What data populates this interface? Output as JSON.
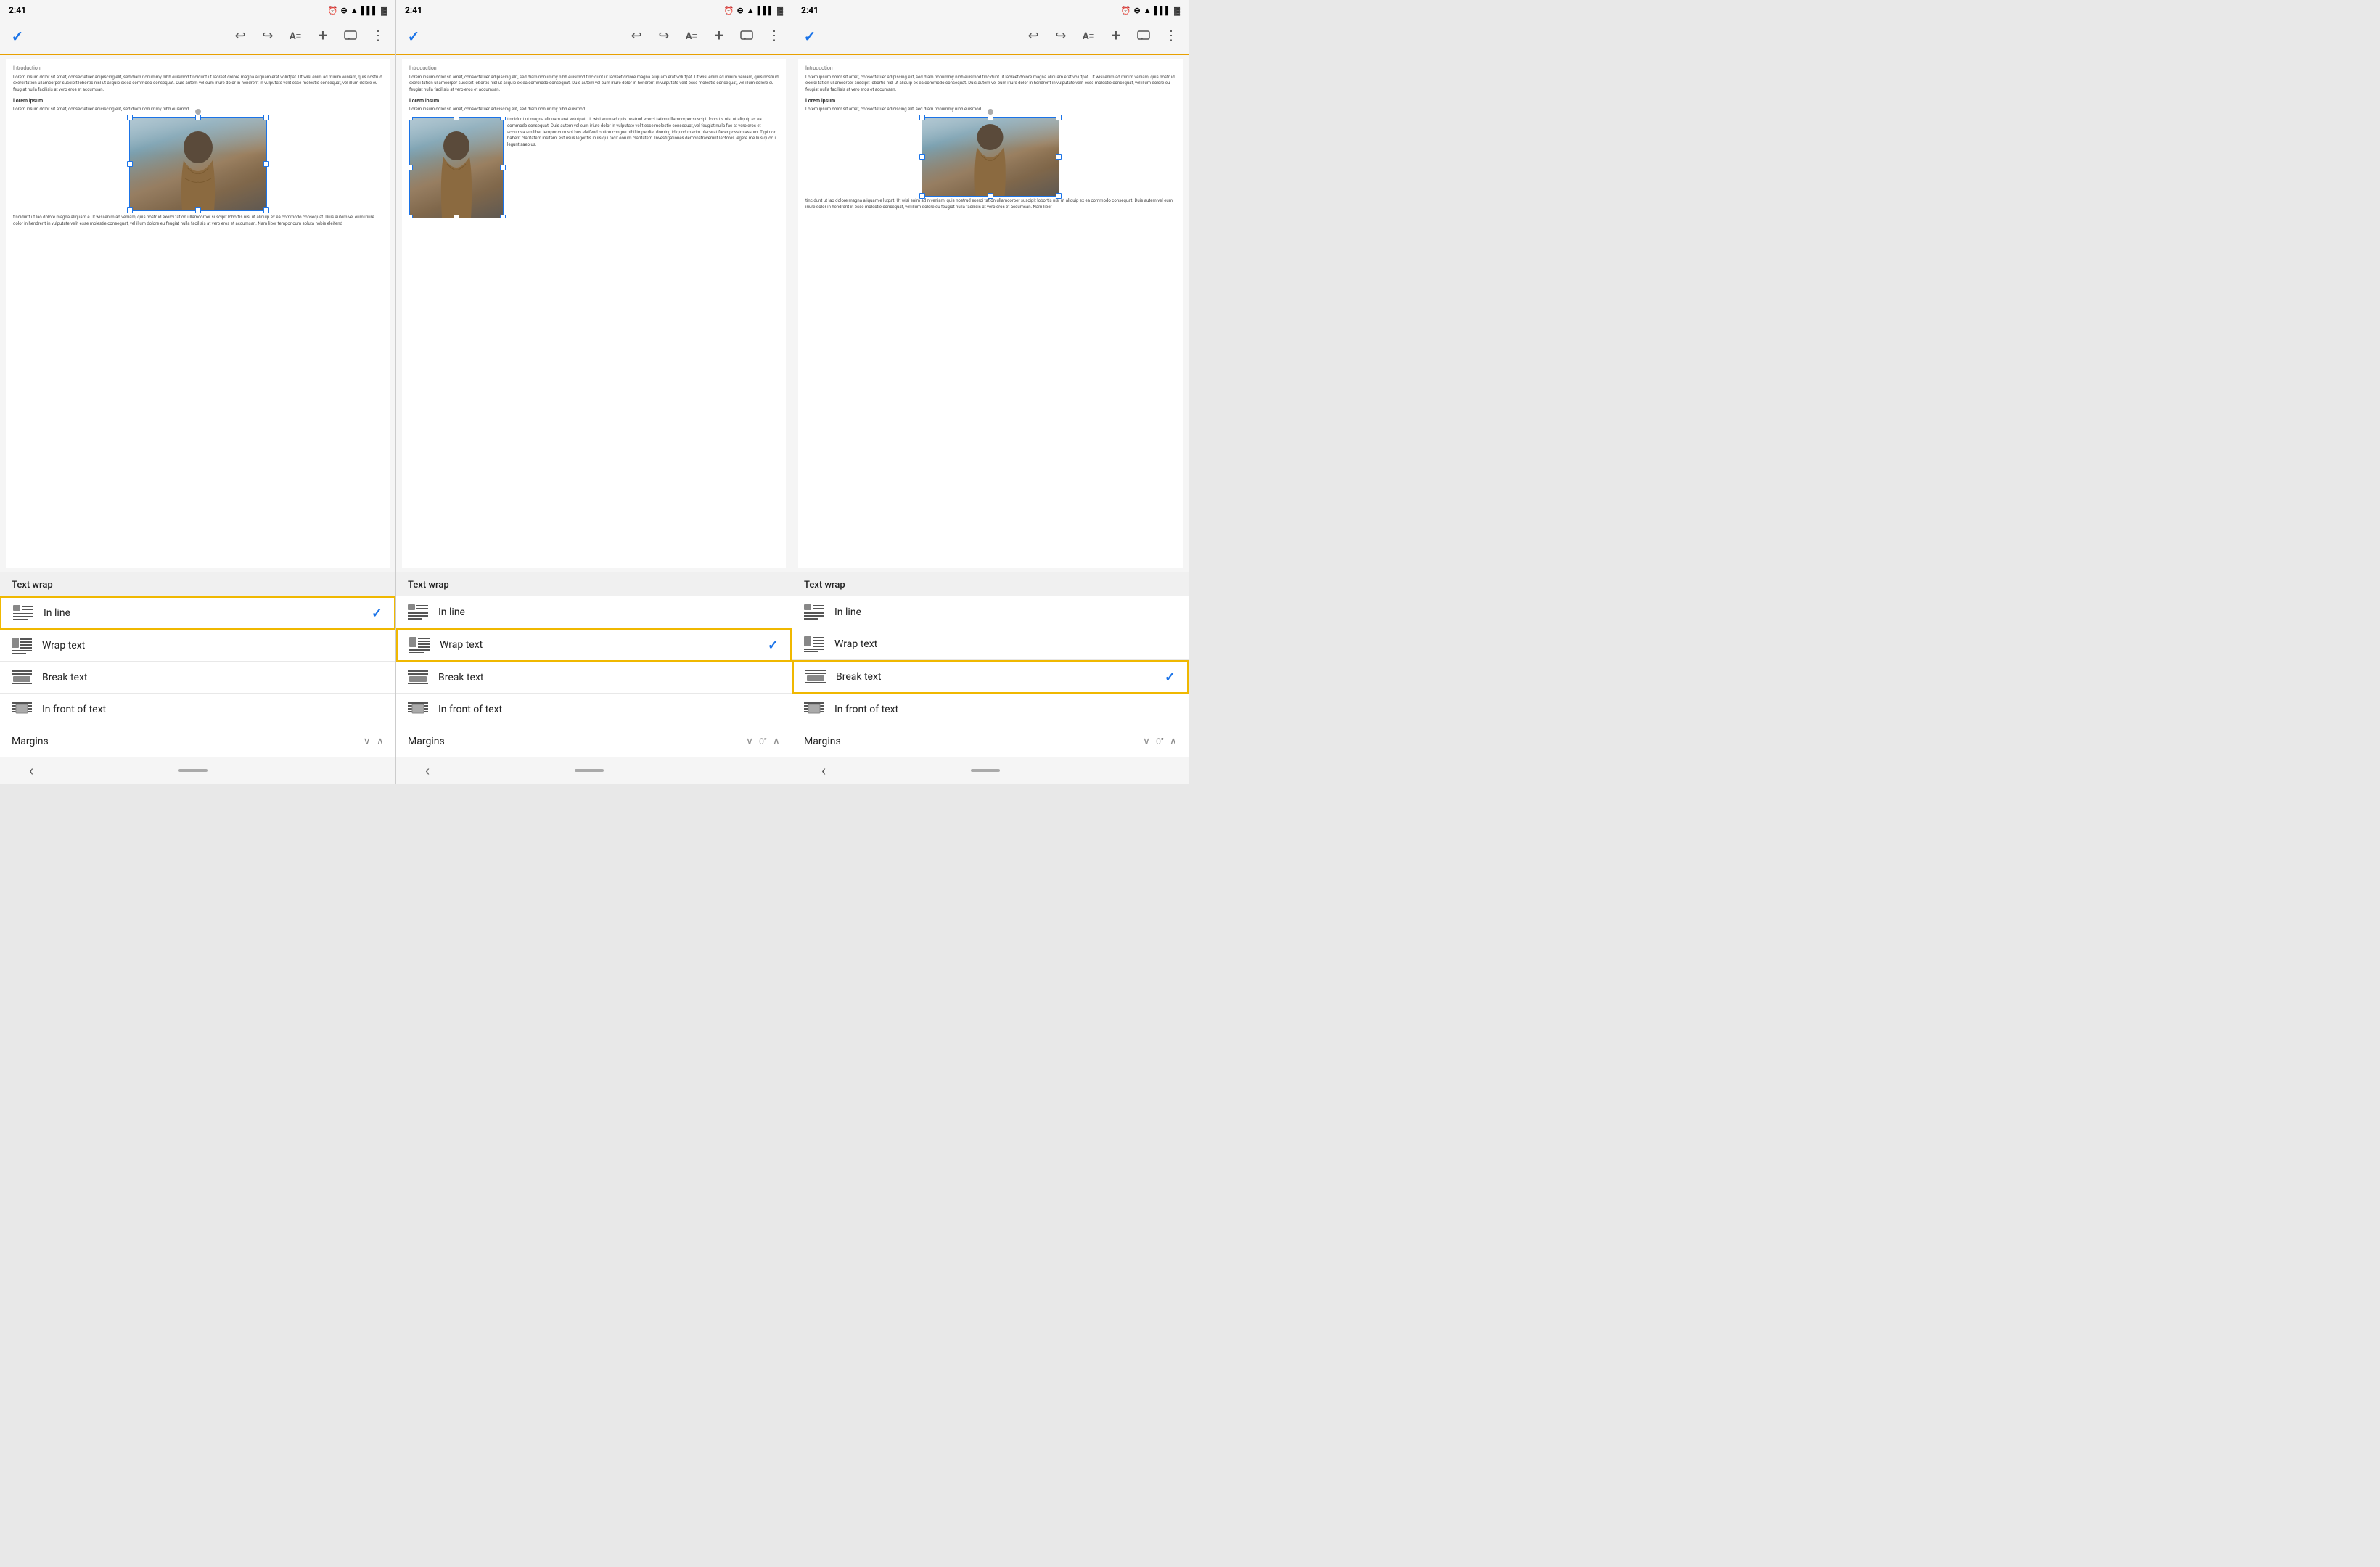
{
  "panels": [
    {
      "id": "panel1",
      "time": "2:41",
      "toolbar": {
        "check": "✓",
        "undo": "↩",
        "redo": "↪",
        "format": "A≡",
        "add": "+",
        "comment": "💬",
        "more": "⋮"
      },
      "doc": {
        "intro_label": "Introduction",
        "body_text": "Lorem ipsum dolor sit amet, consectetuer adipiscing elit, sed diam nonummy nibh euismod tincidunt ut laoreet dolore magna aliquam erat volutpat. Ut wisi enim ad minim veniam, quis nostrud exerci tation ullamcorper suscipit lobortis nisl ut aliquip ex ea commodo consequat. Duis autem vel eum iriure dolor in hendrerit in vulputate velit esse molestie consequat, vel illum dolore eu feugiat nulla facilisis at vero eros et accumsan.",
        "bold_heading": "Lorem ipsum",
        "sub_text": "Lorem ipsum dolor sit amet, consectetuer adiciscing elit, sed diam nonummy nibh euismod",
        "text_after": "tincidunt ut laor    dolore magna aliquam e    Ut wisi enim ad    veniam, quis nostrud exerci tation ullamcorper suscipit lobortis nisl ut aliquip ex ea commodo consequat. Duis autem vel eum iriure dolor in hendrerit in vulputate velit esse molestie consequat, vel illum dolore eu feugiat nulla facilisis at vero eros et accumsan. Nam liber tempor cum soluta nobis eleifend"
      },
      "wrap_type": "inline",
      "textwrap": {
        "header": "Text wrap",
        "items": [
          {
            "id": "inline",
            "label": "In line",
            "selected": true,
            "checked": true
          },
          {
            "id": "wrap",
            "label": "Wrap text",
            "selected": false,
            "checked": false
          },
          {
            "id": "break",
            "label": "Break text",
            "selected": false,
            "checked": false
          },
          {
            "id": "front",
            "label": "In front of text",
            "selected": false,
            "checked": false
          }
        ],
        "margins_label": "Margins",
        "margins_value": ""
      }
    },
    {
      "id": "panel2",
      "time": "2:41",
      "wrap_type": "wrap",
      "textwrap": {
        "header": "Text wrap",
        "items": [
          {
            "id": "inline",
            "label": "In line",
            "selected": false,
            "checked": false
          },
          {
            "id": "wrap",
            "label": "Wrap text",
            "selected": true,
            "checked": true
          },
          {
            "id": "break",
            "label": "Break text",
            "selected": false,
            "checked": false
          },
          {
            "id": "front",
            "label": "In front of text",
            "selected": false,
            "checked": false
          }
        ],
        "margins_label": "Margins",
        "margins_value": "0\""
      }
    },
    {
      "id": "panel3",
      "time": "2:41",
      "wrap_type": "break",
      "textwrap": {
        "header": "Text wrap",
        "items": [
          {
            "id": "inline",
            "label": "In line",
            "selected": false,
            "checked": false
          },
          {
            "id": "wrap",
            "label": "Wrap text",
            "selected": false,
            "checked": false
          },
          {
            "id": "break",
            "label": "Break text",
            "selected": true,
            "checked": true
          },
          {
            "id": "front",
            "label": "In front of text",
            "selected": false,
            "checked": false
          }
        ],
        "margins_label": "Margins",
        "margins_value": "0\""
      }
    }
  ],
  "icons": {
    "check": "✓",
    "undo": "↩",
    "redo": "↪",
    "add": "+",
    "more": "⋮",
    "back": "‹",
    "chevron_down": "∨",
    "chevron_up": "∧"
  },
  "status": {
    "time": "2:41",
    "signal_icon": "📶",
    "wifi_icon": "▲",
    "battery_icon": "🔋"
  },
  "doc": {
    "intro_label": "Introduction",
    "body_text": "Lorem ipsum dolor sit amet, consectetuer adipiscing elit, sed diam nonummy nibh euismod tincidunt ut laoreet dolore magna aliquam erat volutpat. Ut wisi enim ad minim veniam, quis nostrud exerci tation ullamcorper suscipit lobortis nisl ut aliquip ex ea commodo consequat. Duis autem vel eum iriure dolor in hendrerit in vulputate velit esse molestie consequat, vel illum dolore eu feugiat nulla facilisis at vero eros et accumsan.",
    "bold_heading": "Lorem ipsum",
    "lorem_sub": "Lorem ipsum dolor sit amet, consectetuer adiciscing elit, sed diam nonummy nibh euismod"
  }
}
